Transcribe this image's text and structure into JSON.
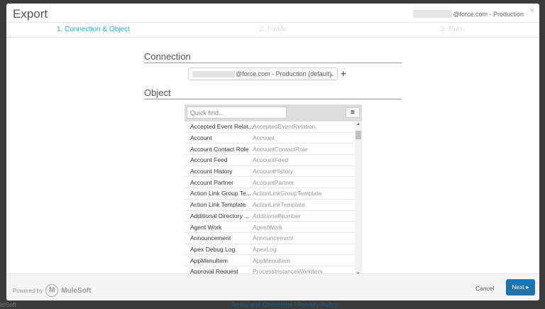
{
  "background": {
    "left_text": "leSoft",
    "footer_links": "Terms and Conditions - Privacy Policy"
  },
  "header": {
    "title": "Export",
    "account": "@force.com - Production",
    "close": "×"
  },
  "steps": [
    "1. Connection & Object",
    "2. Fields",
    "3. Run"
  ],
  "connection": {
    "heading": "Connection",
    "selected": "@force.com - Production (default)",
    "add": "+"
  },
  "object": {
    "heading": "Object",
    "search_placeholder": "Quick find...",
    "rows": [
      [
        "Accepted Event Relat...",
        "AcceptedEventRelation"
      ],
      [
        "Account",
        "Account"
      ],
      [
        "Account Contact Role",
        "AccountContactRole"
      ],
      [
        "Account Feed",
        "AccountFeed"
      ],
      [
        "Account History",
        "AccountHistory"
      ],
      [
        "Account Partner",
        "AccountPartner"
      ],
      [
        "Action Link Group Te...",
        "ActionLinkGroupTemplate"
      ],
      [
        "Action Link Template",
        "ActionLinkTemplate"
      ],
      [
        "Additional Directory ...",
        "AdditionalNumber"
      ],
      [
        "Agent Work",
        "AgentWork"
      ],
      [
        "Announcement",
        "Announcement"
      ],
      [
        "Apex Debug Log",
        "ApexLog"
      ],
      [
        "AppMenuItem",
        "AppMenuItem"
      ],
      [
        "Approval Request",
        "ProcessInstanceWorkitem"
      ]
    ]
  },
  "footer": {
    "powered_by": "Powered by",
    "brand": "MuleSoft",
    "cancel": "Cancel",
    "next": "Next"
  }
}
